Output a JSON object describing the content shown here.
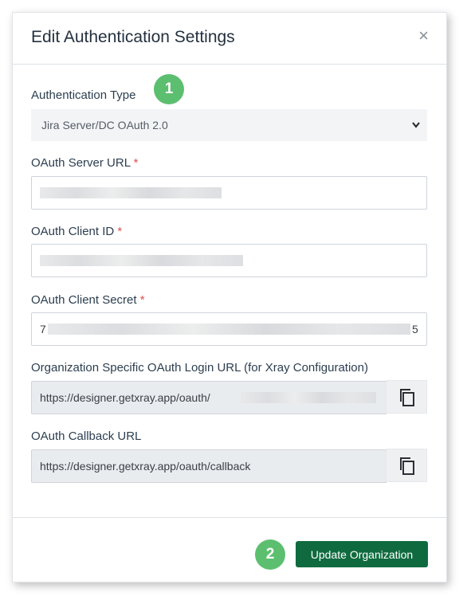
{
  "modal": {
    "title": "Edit Authentication Settings",
    "close_glyph": "×"
  },
  "auth_type": {
    "label": "Authentication Type",
    "selected": "Jira Server/DC OAuth 2.0",
    "step": "1"
  },
  "server_url": {
    "label": "OAuth Server URL",
    "required_mark": "*"
  },
  "client_id": {
    "label": "OAuth Client ID",
    "required_mark": "*"
  },
  "client_secret": {
    "label": "OAuth Client Secret",
    "required_mark": "*",
    "value_start": "7",
    "value_end": "5"
  },
  "org_login_url": {
    "label": "Organization Specific OAuth Login URL (for Xray Configuration)",
    "value": "https://designer.getxray.app/oauth/"
  },
  "callback_url": {
    "label": "OAuth Callback URL",
    "value": "https://designer.getxray.app/oauth/callback"
  },
  "footer": {
    "step": "2",
    "update_label": "Update Organization",
    "button_color": "#0f6b3f"
  },
  "icons": {
    "copy": "copy-icon",
    "close": "close-icon",
    "chevron": "chevron-down-icon"
  }
}
